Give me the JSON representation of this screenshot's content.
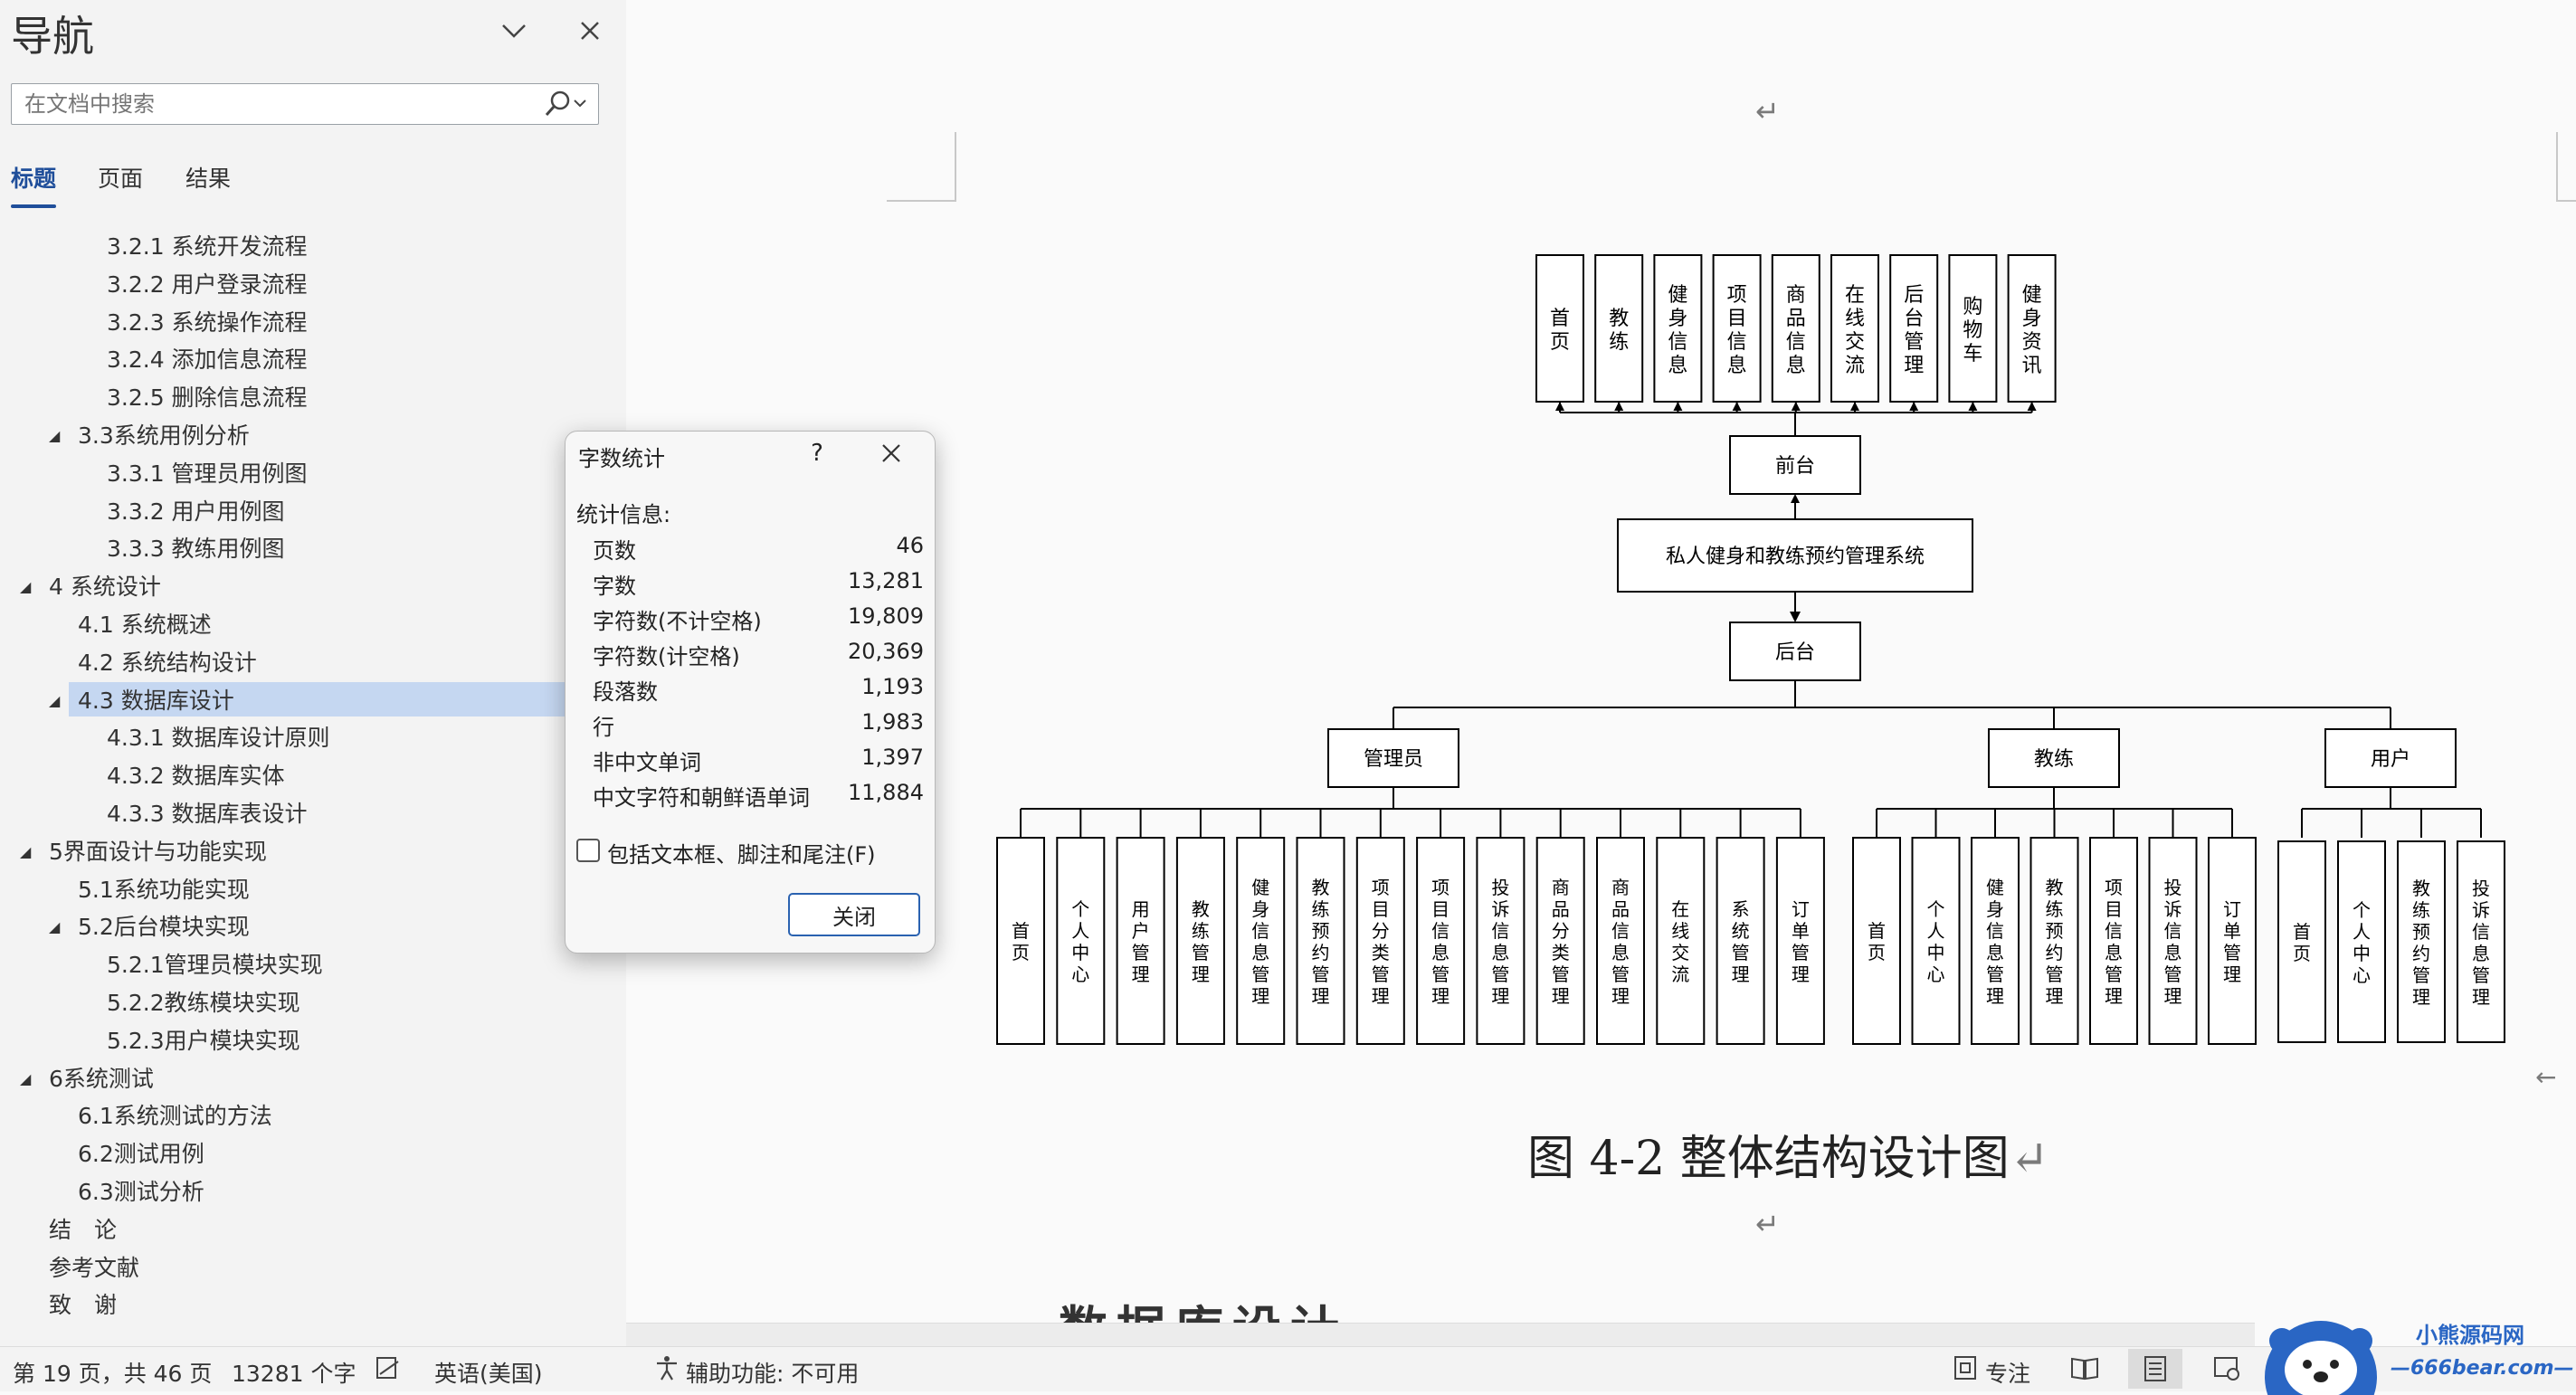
{
  "nav": {
    "title": "导航",
    "search_placeholder": "在文档中搜索",
    "tabs": [
      "标题",
      "页面",
      "结果"
    ],
    "items": [
      {
        "label": "3.2.1 系统开发流程",
        "level": 3
      },
      {
        "label": "3.2.2 用户登录流程",
        "level": 3
      },
      {
        "label": "3.2.3 系统操作流程",
        "level": 3
      },
      {
        "label": "3.2.4 添加信息流程",
        "level": 3
      },
      {
        "label": "3.2.5 删除信息流程",
        "level": 3
      },
      {
        "label": "3.3系统用例分析",
        "level": 2,
        "expanded": true
      },
      {
        "label": "3.3.1 管理员用例图",
        "level": 3
      },
      {
        "label": "3.3.2 用户用例图",
        "level": 3
      },
      {
        "label": "3.3.3 教练用例图",
        "level": 3
      },
      {
        "label": "4 系统设计",
        "level": 1,
        "expanded": true
      },
      {
        "label": "4.1 系统概述",
        "level": 2
      },
      {
        "label": "4.2 系统结构设计",
        "level": 2
      },
      {
        "label": "4.3 数据库设计",
        "level": 2,
        "expanded": true,
        "selected": true
      },
      {
        "label": "4.3.1 数据库设计原则",
        "level": 3
      },
      {
        "label": "4.3.2 数据库实体",
        "level": 3
      },
      {
        "label": "4.3.3 数据库表设计",
        "level": 3
      },
      {
        "label": "5界面设计与功能实现",
        "level": 1,
        "expanded": true
      },
      {
        "label": "5.1系统功能实现",
        "level": 2
      },
      {
        "label": "5.2后台模块实现",
        "level": 2,
        "expanded": true
      },
      {
        "label": "5.2.1管理员模块实现",
        "level": 3
      },
      {
        "label": "5.2.2教练模块实现",
        "level": 3
      },
      {
        "label": "5.2.3用户模块实现",
        "level": 3
      },
      {
        "label": "6系统测试",
        "level": 1,
        "expanded": true
      },
      {
        "label": "6.1系统测试的方法",
        "level": 2
      },
      {
        "label": "6.2测试用例",
        "level": 2
      },
      {
        "label": "6.3测试分析",
        "level": 2
      },
      {
        "label": "结　论",
        "level": 1
      },
      {
        "label": "参考文献",
        "level": 1
      },
      {
        "label": "致　谢",
        "level": 1
      }
    ]
  },
  "dialog": {
    "title": "字数统计",
    "help": "?",
    "stats_heading": "统计信息:",
    "stats": [
      {
        "label": "页数",
        "value": "46"
      },
      {
        "label": "字数",
        "value": "13,281"
      },
      {
        "label": "字符数(不计空格)",
        "value": "19,809"
      },
      {
        "label": "字符数(计空格)",
        "value": "20,369"
      },
      {
        "label": "段落数",
        "value": "1,193"
      },
      {
        "label": "行",
        "value": "1,983"
      },
      {
        "label": "非中文单词",
        "value": "1,397"
      },
      {
        "label": "中文字符和朝鲜语单词",
        "value": "11,884"
      }
    ],
    "checkbox_label": "包括文本框、脚注和尾注(F)",
    "checkbox_checked": false,
    "close_label": "关闭"
  },
  "document": {
    "para_mark": "↵",
    "diagram": {
      "top_items": [
        "首页",
        "教练",
        "健身信息",
        "项目信息",
        "商品信息",
        "在线交流",
        "后台管理",
        "购物车",
        "健身资讯"
      ],
      "front": "前台",
      "system": "私人健身和教练预约管理系统",
      "back": "后台",
      "roles": [
        {
          "name": "管理员",
          "items": [
            "首页",
            "个人中心",
            "用户管理",
            "教练管理",
            "健身信息管理",
            "教练预约管理",
            "项目分类管理",
            "项目信息管理",
            "投诉信息管理",
            "商品分类管理",
            "商品信息管理",
            "在线交流",
            "系统管理",
            "订单管理"
          ]
        },
        {
          "name": "教练",
          "items": [
            "首页",
            "个人中心",
            "健身信息管理",
            "教练预约管理",
            "项目信息管理",
            "投诉信息管理",
            "订单管理"
          ]
        },
        {
          "name": "用户",
          "items": [
            "首页",
            "个人中心",
            "教练预约管理",
            "投诉信息管理"
          ]
        }
      ]
    },
    "caption": "图 4-2  整体结构设计图",
    "next_heading_cut": "数据库设计"
  },
  "status": {
    "page": "第 19 页，共 46 页",
    "words": "13281 个字",
    "language": "英语(美国)",
    "accessibility": "辅助功能: 不可用",
    "focus": "专注"
  },
  "watermark": {
    "line1": "小熊源码网",
    "line2": "—666bear.com—"
  }
}
